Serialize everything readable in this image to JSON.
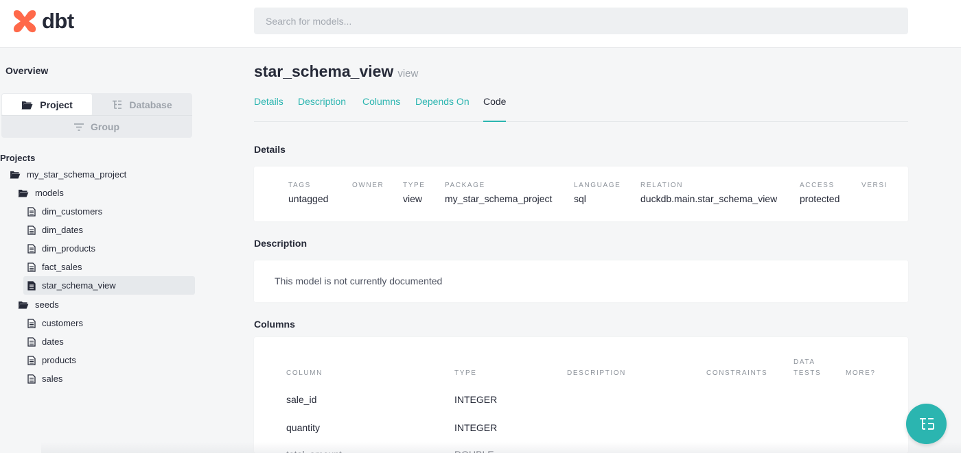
{
  "header": {
    "logo_text": "dbt",
    "brand_color": "#ff694a",
    "search_placeholder": "Search for models..."
  },
  "sidebar": {
    "overview_label": "Overview",
    "switcher": {
      "project_label": "Project",
      "database_label": "Database",
      "group_label": "Group",
      "active": "Project"
    },
    "projects_heading": "Projects",
    "project_name": "my_star_schema_project",
    "models_folder": "models",
    "models": [
      "dim_customers",
      "dim_dates",
      "dim_products",
      "fact_sales",
      "star_schema_view"
    ],
    "selected_model": "star_schema_view",
    "seeds_folder": "seeds",
    "seeds": [
      "customers",
      "dates",
      "products",
      "sales"
    ]
  },
  "main": {
    "title": "star_schema_view",
    "title_type": "view",
    "tabs": [
      "Details",
      "Description",
      "Columns",
      "Depends On",
      "Code"
    ],
    "active_tab": "Code",
    "accent_color": "#2bb5b0",
    "details": {
      "heading": "Details",
      "fields": [
        {
          "label": "TAGS",
          "value": "untagged"
        },
        {
          "label": "OWNER",
          "value": ""
        },
        {
          "label": "TYPE",
          "value": "view"
        },
        {
          "label": "PACKAGE",
          "value": "my_star_schema_project"
        },
        {
          "label": "LANGUAGE",
          "value": "sql"
        },
        {
          "label": "RELATION",
          "value": "duckdb.main.star_schema_view"
        },
        {
          "label": "ACCESS",
          "value": "protected"
        },
        {
          "label": "VERSI",
          "value": ""
        }
      ]
    },
    "description": {
      "heading": "Description",
      "text": "This model is not currently documented"
    },
    "columns": {
      "heading": "Columns",
      "headers": {
        "column": "COLUMN",
        "type": "TYPE",
        "description": "DESCRIPTION",
        "constraints": "CONSTRAINTS",
        "data_tests_line1": "DATA",
        "data_tests_line2": "TESTS",
        "more": "MORE?"
      },
      "rows": [
        {
          "name": "sale_id",
          "type": "INTEGER"
        },
        {
          "name": "quantity",
          "type": "INTEGER"
        },
        {
          "name": "total_amount",
          "type": "DOUBLE"
        }
      ]
    }
  },
  "fab": {
    "icon": "tree-hierarchy-icon"
  }
}
